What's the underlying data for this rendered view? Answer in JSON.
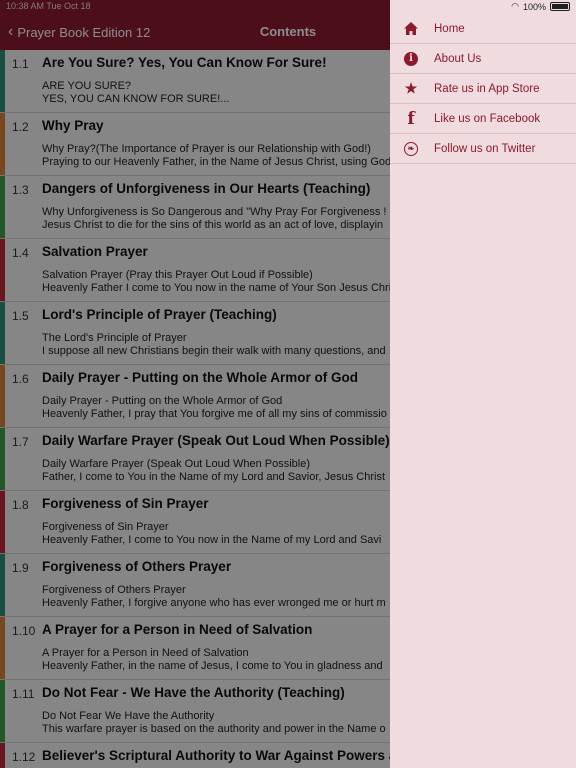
{
  "status": {
    "time_date": "10:38 AM   Tue Oct 18",
    "battery": "100%"
  },
  "nav": {
    "back_label": "Prayer Book Edition 12",
    "title": "Contents"
  },
  "colors": {
    "accent": "#8b1a2c",
    "menu_bg": "#f0dcdf"
  },
  "rows": [
    {
      "num": "1.1",
      "title": "Are You Sure? Yes, You Can Know For Sure!",
      "sub1": "ARE YOU SURE?",
      "sub2": "YES, YOU CAN KNOW FOR SURE!...",
      "stripe": "#2f8f7e"
    },
    {
      "num": "1.2",
      "title": "Why Pray",
      "sub1": "Why Pray?(The Importance of Prayer is our Relationship with God!)",
      "sub2": "Praying to our Heavenly Father, in the Name of Jesus Christ, using God",
      "stripe": "#d9843a"
    },
    {
      "num": "1.3",
      "title": "Dangers of Unforgiveness in Our Hearts (Teaching)",
      "sub1": "Why Unforgiveness is So Dangerous and \"Why Pray For Forgiveness !",
      "sub2": "Jesus Christ to die for the sins of this world as an act of love, displayin",
      "stripe": "#3ea04a"
    },
    {
      "num": "1.4",
      "title": "Salvation Prayer",
      "sub1": "Salvation Prayer    (Pray this Prayer Out Loud if Possible)",
      "sub2": "Heavenly Father I come to You now in the name of Your Son Jesus Chri",
      "stripe": "#c0283c"
    },
    {
      "num": "1.5",
      "title": "Lord's Principle of Prayer (Teaching)",
      "sub1": "The Lord's Principle of Prayer",
      "sub2": "I suppose all new Christians begin their walk with many questions, and",
      "stripe": "#2f8f7e"
    },
    {
      "num": "1.6",
      "title": "Daily Prayer - Putting on the Whole Armor of God",
      "sub1": "Daily Prayer - Putting on the Whole Armor of God",
      "sub2": "Heavenly Father, I pray that You forgive me of all my sins of commissio",
      "stripe": "#d9843a"
    },
    {
      "num": "1.7",
      "title": "Daily Warfare Prayer (Speak Out Loud When Possible)",
      "sub1": "Daily Warfare Prayer (Speak Out Loud When Possible)",
      "sub2": "Father, I come to You in the Name of my Lord and Savior, Jesus Christ",
      "stripe": "#3ea04a"
    },
    {
      "num": "1.8",
      "title": "Forgiveness of Sin Prayer",
      "sub1": "Forgiveness of Sin Prayer",
      "sub2": "Heavenly Father, I  come to You now in the Name of my  Lord and Savi",
      "stripe": "#c0283c"
    },
    {
      "num": "1.9",
      "title": "Forgiveness of Others Prayer",
      "sub1": "Forgiveness of Others Prayer",
      "sub2": "Heavenly Father, I forgive anyone who has ever wronged me or hurt m",
      "stripe": "#2f8f7e"
    },
    {
      "num": "1.10",
      "title": "A Prayer for a Person in Need of Salvation",
      "sub1": "A Prayer for a Person in Need of Salvation",
      "sub2": "Heavenly Father, in the name of Jesus, I come to You in gladness and",
      "stripe": "#d9843a"
    },
    {
      "num": "1.11",
      "title": "Do Not Fear - We Have the Authority (Teaching)",
      "sub1": "Do Not Fear We Have the Authority",
      "sub2": "This warfare prayer is based on the authority and power in the Name o",
      "stripe": "#3ea04a"
    },
    {
      "num": "1.12",
      "title": "Believer's Scriptural Authority to War Against Powers and",
      "sub1": "",
      "sub2": "",
      "stripe": "#c0283c"
    }
  ],
  "menu": {
    "items": [
      {
        "label": "Home",
        "icon": "home-icon"
      },
      {
        "label": "About Us",
        "icon": "info-icon"
      },
      {
        "label": "Rate us in App Store",
        "icon": "star-icon"
      },
      {
        "label": "Like us on Facebook",
        "icon": "facebook-icon"
      },
      {
        "label": "Follow us on Twitter",
        "icon": "twitter-icon"
      }
    ]
  }
}
